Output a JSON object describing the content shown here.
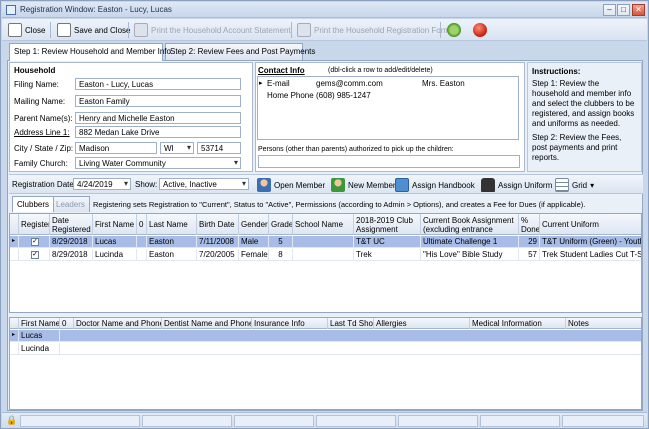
{
  "window": {
    "title": "Registration Window: Easton - Lucy, Lucas"
  },
  "toolbar": {
    "close": "Close",
    "save_close": "Save and Close",
    "print_statement": "Print the Household Account Statement",
    "print_registration": "Print the Household Registration Form"
  },
  "tabs": [
    "Step 1: Review Household and Member Info",
    "Step 2: Review Fees and Post Payments"
  ],
  "household": {
    "title": "Household",
    "filing_name_label": "Filing Name:",
    "filing_name": "Easton - Lucy, Lucas",
    "mailing_name_label": "Mailing Name:",
    "mailing_name": "Easton Family",
    "parent_label": "Parent Name(s):",
    "parent": "Henry and Michelle Easton",
    "address_label": "Address Line 1:",
    "address": "882 Medan Lake Drive",
    "city_label": "City / State / Zip:",
    "city": "Madison",
    "state": "WI",
    "zip": "53714",
    "church_label": "Family Church:",
    "church": "Living Water Community"
  },
  "contact": {
    "title": "Contact Info",
    "hint": "(dbl-click a row to add/edit/delete)",
    "rows": [
      {
        "type": "E-mail",
        "value": "gems@comm.com",
        "name": "Mrs. Easton"
      },
      {
        "type": "Home Phone",
        "value": "(608) 985-1247",
        "name": ""
      }
    ],
    "pickup_label": "Persons (other than parents) authorized to pick up the children:"
  },
  "instructions": {
    "title": "Instructions:",
    "step1": "Step 1: Review the household and member info and select the clubbers to be registered, and assign books and uniforms as needed.",
    "step2": "Step 2: Review the Fees, post payments and print reports."
  },
  "filter": {
    "date_label": "Registration Date:",
    "date": "4/24/2019",
    "show_label": "Show:",
    "show": "Active, Inactive",
    "open_member": "Open Member",
    "new_member": "New Member",
    "assign_handbook": "Assign Handbook",
    "assign_uniform": "Assign Uniform",
    "grid": "Grid"
  },
  "subtabs": {
    "clubbers": "Clubbers",
    "leaders": "Leaders",
    "note": "Registering sets Registration to \"Current\", Status to \"Active\", Permissions (according to Admin > Options), and creates a Fee for Dues (if applicable)."
  },
  "members": {
    "headers": [
      "Register",
      "Date Registered",
      "First Name",
      "0",
      "Last Name",
      "Birth Date",
      "Gender",
      "Grade",
      "School Name",
      "2018-2019 Club Assignment",
      "Current Book Assignment (excluding entrance books)",
      "% Done",
      "Current Uniform"
    ],
    "rows": [
      {
        "date": "8/29/2018",
        "first": "Lucas",
        "last": "Easton",
        "birth": "7/11/2008",
        "gender": "Male",
        "grade": "5",
        "school": "",
        "club": "T&T UC",
        "book": "Ultimate Challenge 1",
        "done": "29",
        "uniform": "T&T Uniform (Green) - Youth"
      },
      {
        "date": "8/29/2018",
        "first": "Lucinda",
        "last": "Easton",
        "birth": "7/20/2005",
        "gender": "Female",
        "grade": "8",
        "school": "",
        "club": "Trek",
        "book": "\"His Love\" Bible Study",
        "done": "57",
        "uniform": "Trek Student Ladies Cut T-Shi"
      }
    ]
  },
  "medical": {
    "headers": [
      "First Name",
      "0",
      "Doctor Name and Phone",
      "Dentist Name and Phone",
      "Insurance Info",
      "Last Td Shot",
      "Allergies",
      "Medical Information",
      "Notes"
    ],
    "rows": [
      "Lucas",
      "Lucinda"
    ]
  },
  "colors": {
    "accent": "#c7d6f2",
    "selected": "#a7bde8",
    "chrome": "#c9d7ea"
  }
}
